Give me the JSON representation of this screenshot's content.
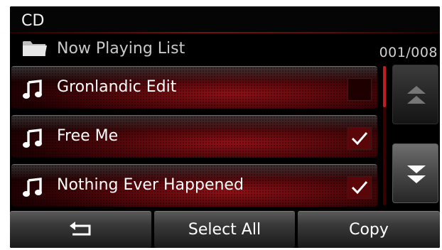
{
  "app": {
    "title": "CD"
  },
  "list": {
    "title": "Now Playing List",
    "counter": "001/008",
    "folder_icon": "folder-icon"
  },
  "tracks": [
    {
      "title": "Gronlandic Edit",
      "icon": "music-note-icon",
      "checked": false
    },
    {
      "title": "Free Me",
      "icon": "music-note-icon",
      "checked": true
    },
    {
      "title": "Nothing Ever Happened",
      "icon": "music-note-icon",
      "checked": true
    }
  ],
  "scroll": {
    "up_icon": "double-chevron-up-icon",
    "down_icon": "double-chevron-down-icon",
    "up_enabled": false,
    "down_enabled": true
  },
  "bottom": {
    "back_icon": "back-arrow-icon",
    "select_all_label": "Select All",
    "copy_label": "Copy"
  },
  "colors": {
    "accent_red": "#c51a22",
    "row_red": "#96121a",
    "background": "#000000",
    "text": "#ffffff"
  }
}
